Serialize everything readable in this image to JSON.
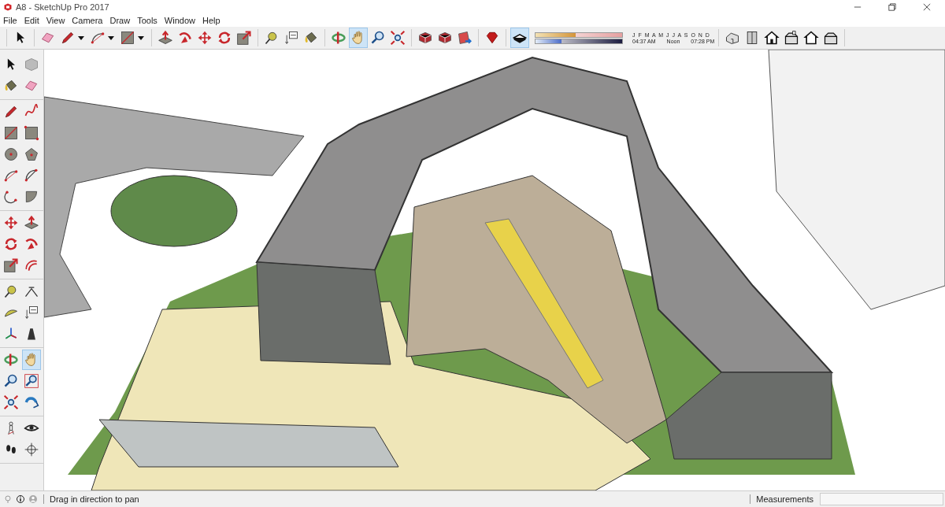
{
  "window": {
    "title": "A8 - SketchUp Pro 2017"
  },
  "menu": [
    "File",
    "Edit",
    "View",
    "Camera",
    "Draw",
    "Tools",
    "Window",
    "Help"
  ],
  "toolbar": {
    "groups": [
      [
        {
          "kind": "select",
          "selected": false
        }
      ],
      [
        {
          "kind": "eraser",
          "selected": false
        },
        {
          "kind": "pencil",
          "selected": false,
          "menu": true
        },
        {
          "kind": "arc",
          "selected": false,
          "menu": true
        },
        {
          "kind": "rectangle",
          "selected": false,
          "menu": true
        }
      ],
      [
        {
          "kind": "pushpull",
          "selected": false
        },
        {
          "kind": "followme",
          "selected": false
        },
        {
          "kind": "move",
          "selected": false
        },
        {
          "kind": "rotate",
          "selected": false
        },
        {
          "kind": "scale",
          "selected": false
        }
      ],
      [
        {
          "kind": "tape",
          "selected": false
        },
        {
          "kind": "text",
          "selected": false
        },
        {
          "kind": "paint",
          "selected": false
        }
      ],
      [
        {
          "kind": "orbit",
          "selected": false
        },
        {
          "kind": "pan",
          "selected": true
        },
        {
          "kind": "zoom",
          "selected": false
        },
        {
          "kind": "extents",
          "selected": false
        }
      ],
      [
        {
          "kind": "warehouse",
          "selected": false
        },
        {
          "kind": "warehouse",
          "selected": false
        },
        {
          "kind": "share",
          "selected": false
        }
      ],
      [
        {
          "kind": "ruby",
          "selected": false
        }
      ],
      [
        {
          "kind": "shadows",
          "selected": true
        }
      ]
    ],
    "shadow_settings": {
      "months": "J F M A M J J A S O N D",
      "date": {
        "level": 0.46
      },
      "time": {
        "level": 0.3
      },
      "sunrise": "04:37 AM",
      "noon": "Noon",
      "sunset": "07:28 PM"
    },
    "views": [
      {
        "kind": "iso"
      },
      {
        "kind": "top"
      },
      {
        "kind": "front"
      },
      {
        "kind": "right"
      },
      {
        "kind": "back"
      },
      {
        "kind": "left"
      }
    ]
  },
  "left_toolbar": [
    [
      {
        "kind": "select",
        "selected": false
      },
      {
        "kind": "component",
        "selected": false
      },
      {
        "kind": "paint",
        "selected": false
      },
      {
        "kind": "eraser",
        "selected": false
      }
    ],
    [
      {
        "kind": "pencil",
        "selected": false
      },
      {
        "kind": "freehand",
        "selected": false
      },
      {
        "kind": "rectangle",
        "selected": false
      },
      {
        "kind": "rotrect",
        "selected": false
      },
      {
        "kind": "circle",
        "selected": false
      },
      {
        "kind": "polygon",
        "selected": false
      },
      {
        "kind": "arc",
        "selected": false
      },
      {
        "kind": "arc2",
        "selected": false
      },
      {
        "kind": "arc3",
        "selected": false
      },
      {
        "kind": "pie",
        "selected": false
      }
    ],
    [
      {
        "kind": "move",
        "selected": false
      },
      {
        "kind": "pushpull",
        "selected": false
      },
      {
        "kind": "rotate",
        "selected": false
      },
      {
        "kind": "followme",
        "selected": false
      },
      {
        "kind": "scale",
        "selected": false
      },
      {
        "kind": "offset",
        "selected": false
      }
    ],
    [
      {
        "kind": "tape",
        "selected": false
      },
      {
        "kind": "dimension",
        "selected": false
      },
      {
        "kind": "protractor",
        "selected": false
      },
      {
        "kind": "text",
        "selected": false
      },
      {
        "kind": "axes",
        "selected": false
      },
      {
        "kind": "text3d",
        "selected": false
      }
    ],
    [
      {
        "kind": "orbit",
        "selected": false
      },
      {
        "kind": "pan",
        "selected": true
      },
      {
        "kind": "zoom",
        "selected": false
      },
      {
        "kind": "zoomwindow",
        "selected": false
      },
      {
        "kind": "extents",
        "selected": false
      },
      {
        "kind": "previous",
        "selected": false
      }
    ],
    [
      {
        "kind": "camera",
        "selected": false
      },
      {
        "kind": "look",
        "selected": false
      },
      {
        "kind": "walk",
        "selected": false
      },
      {
        "kind": "section",
        "selected": false
      }
    ]
  ],
  "status_bar": {
    "icons": [
      {
        "kind": "geo"
      },
      {
        "kind": "info"
      },
      {
        "kind": "user"
      }
    ],
    "message": "Drag in direction to pan",
    "measurements_label": "Measurements"
  }
}
